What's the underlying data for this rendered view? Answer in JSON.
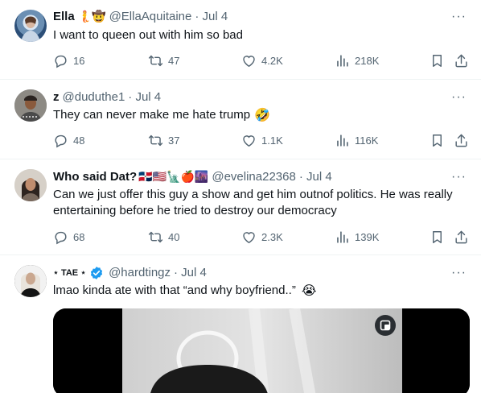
{
  "tweets": [
    {
      "name": "Ella",
      "handle": "@EllaAquitaine",
      "date": "· Jul 4",
      "name_emoji": "🧜🤠",
      "text": "I want to queen out with him so bad",
      "replies": "16",
      "retweets": "47",
      "likes": "4.2K",
      "views": "218K"
    },
    {
      "name": "z",
      "handle": "@duduthe1",
      "date": "· Jul 4",
      "text": "They can never make me hate trump",
      "text_emoji": "🤣",
      "replies": "48",
      "retweets": "37",
      "likes": "1.1K",
      "views": "116K"
    },
    {
      "name": "Who said Dat?",
      "handle": "@evelina22368",
      "date": "· Jul 4",
      "name_emoji": "🇩🇴🇺🇸🗽🍎🌆",
      "text": "Can we just offer this guy a show and get him outnof politics. He was really entertaining before he tried to destroy our democracy",
      "replies": "68",
      "retweets": "40",
      "likes": "2.3K",
      "views": "139K"
    },
    {
      "name": "⋆ TAE ⋆",
      "handle": "@hardtingz",
      "date": "· Jul 4",
      "text": "lmao kinda ate with that “and why boyfriend..”",
      "text_emoji": "😭"
    }
  ],
  "colors": {
    "muted": "#536471",
    "text": "#0f1419",
    "verified": "#1d9bf0",
    "divider": "#eff3f4"
  },
  "icons": [
    "reply-icon",
    "retweet-icon",
    "like-icon",
    "views-icon",
    "bookmark-icon",
    "share-icon",
    "more-icon",
    "verified-badge-icon",
    "expand-media-icon"
  ]
}
